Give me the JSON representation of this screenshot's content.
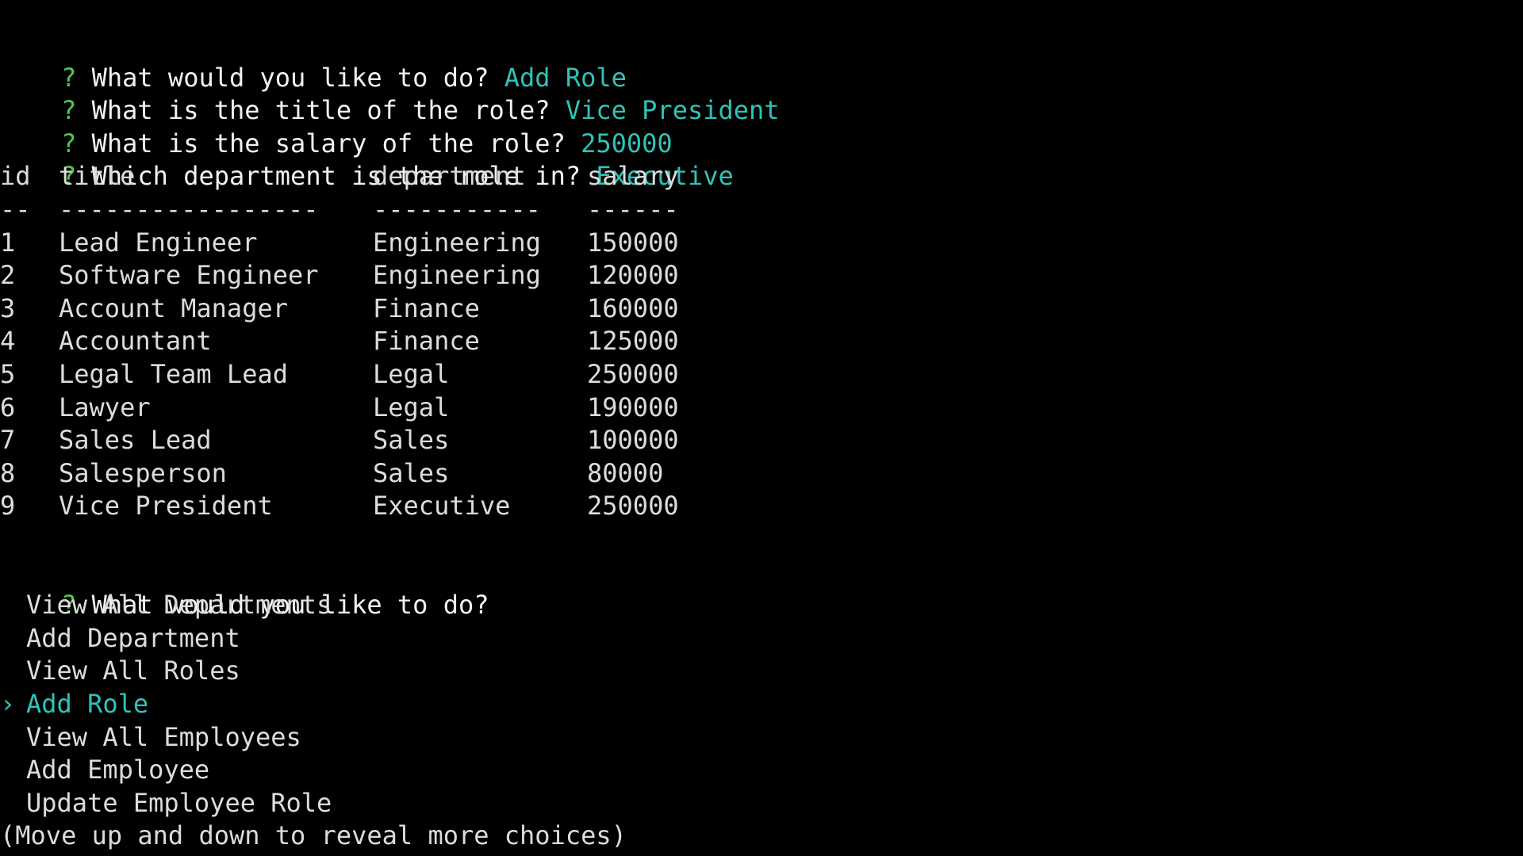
{
  "colors": {
    "background": "#000000",
    "question_mark": "#4ec94e",
    "prompt_text": "#f2f2f2",
    "answer_text": "#2fc3b8",
    "selected_choice": "#2fc3b8"
  },
  "qa": [
    {
      "mark": "?",
      "question": "What would you like to do?",
      "answer": "Add Role"
    },
    {
      "mark": "?",
      "question": "What is the title of the role?",
      "answer": "Vice President"
    },
    {
      "mark": "?",
      "question": "What is the salary of the role?",
      "answer": "250000"
    },
    {
      "mark": "?",
      "question": "Which department is the role in?",
      "answer": "Executive"
    }
  ],
  "table": {
    "headers": [
      "id",
      "title",
      "department",
      "salary"
    ],
    "separators": [
      "--",
      "-----------------",
      "-----------",
      "------"
    ],
    "rows": [
      [
        "1",
        "Lead Engineer",
        "Engineering",
        "150000"
      ],
      [
        "2",
        "Software Engineer",
        "Engineering",
        "120000"
      ],
      [
        "3",
        "Account Manager",
        "Finance",
        "160000"
      ],
      [
        "4",
        "Accountant",
        "Finance",
        "125000"
      ],
      [
        "5",
        "Legal Team Lead",
        "Legal",
        "250000"
      ],
      [
        "6",
        "Lawyer",
        "Legal",
        "190000"
      ],
      [
        "7",
        "Sales Lead",
        "Sales",
        "100000"
      ],
      [
        "8",
        "Salesperson",
        "Sales",
        "80000"
      ],
      [
        "9",
        "Vice President",
        "Executive",
        "250000"
      ]
    ]
  },
  "menu": {
    "mark": "?",
    "question": "What would you like to do?",
    "pointer": "›",
    "choices": [
      "View All Departments",
      "Add Department",
      "View All Roles",
      "Add Role",
      "View All Employees",
      "Add Employee",
      "Update Employee Role"
    ],
    "selected_index": 3,
    "hint": "(Move up and down to reveal more choices)"
  }
}
